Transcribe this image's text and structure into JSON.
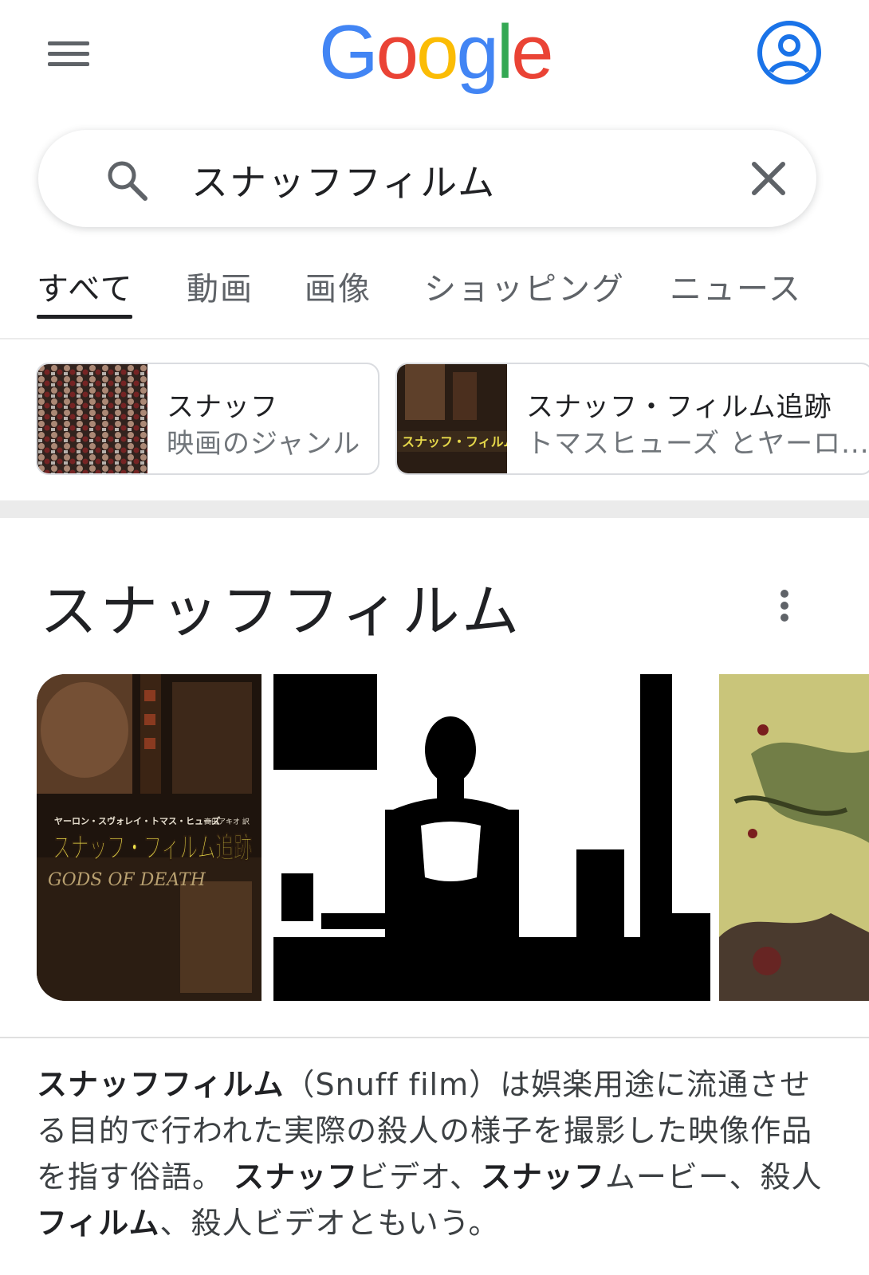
{
  "header": {
    "logo_letters": [
      {
        "ch": "G",
        "color": "#4285f4"
      },
      {
        "ch": "o",
        "color": "#ea4335"
      },
      {
        "ch": "o",
        "color": "#fbbc05"
      },
      {
        "ch": "g",
        "color": "#4285f4"
      },
      {
        "ch": "l",
        "color": "#34a853"
      },
      {
        "ch": "e",
        "color": "#ea4335"
      }
    ],
    "menu_icon": "hamburger-menu-icon",
    "account_icon": "account-circle-icon",
    "account_color": "#1a73e8"
  },
  "search": {
    "query": "スナッフフィルム",
    "search_icon": "search-icon",
    "clear_icon": "close-icon"
  },
  "tabs": [
    {
      "label": "すべて",
      "active": true
    },
    {
      "label": "動画",
      "active": false
    },
    {
      "label": "画像",
      "active": false
    },
    {
      "label": "ショッピング",
      "active": false
    },
    {
      "label": "ニュース",
      "active": false
    }
  ],
  "entity_chips": [
    {
      "title": "スナッフ",
      "subtitle": "映画のジャンル"
    },
    {
      "title": "スナッフ・フィルム追跡",
      "subtitle": "トマスヒューズ とヤーロ..."
    }
  ],
  "knowledge_panel": {
    "title": "スナッフフィルム",
    "more_icon": "more-vert-icon",
    "image1_cover_text": "スナッフ・フィルム追跡",
    "image1_cover_subtext": "ヤーロン・スヴォレイ・トマス・ヒューズ",
    "image1_cover_translator": "高田アキオ 訳",
    "image1_cover_english": "GODS OF DEATH",
    "description": {
      "p1_bold": "スナッフフィルム",
      "p1_text": "（Snuff film）は娯楽用途に流通させる目的で行われた実際の殺人の様子を撮影した映像作品を指す俗語。",
      "p2_bold": "スナッフ",
      "p2_text": "ビデオ、",
      "p3_bold": "スナッフ",
      "p3_text": "ムービー、殺人",
      "p4_bold": "フィルム",
      "p4_text": "、殺人ビデオともいう。"
    }
  }
}
